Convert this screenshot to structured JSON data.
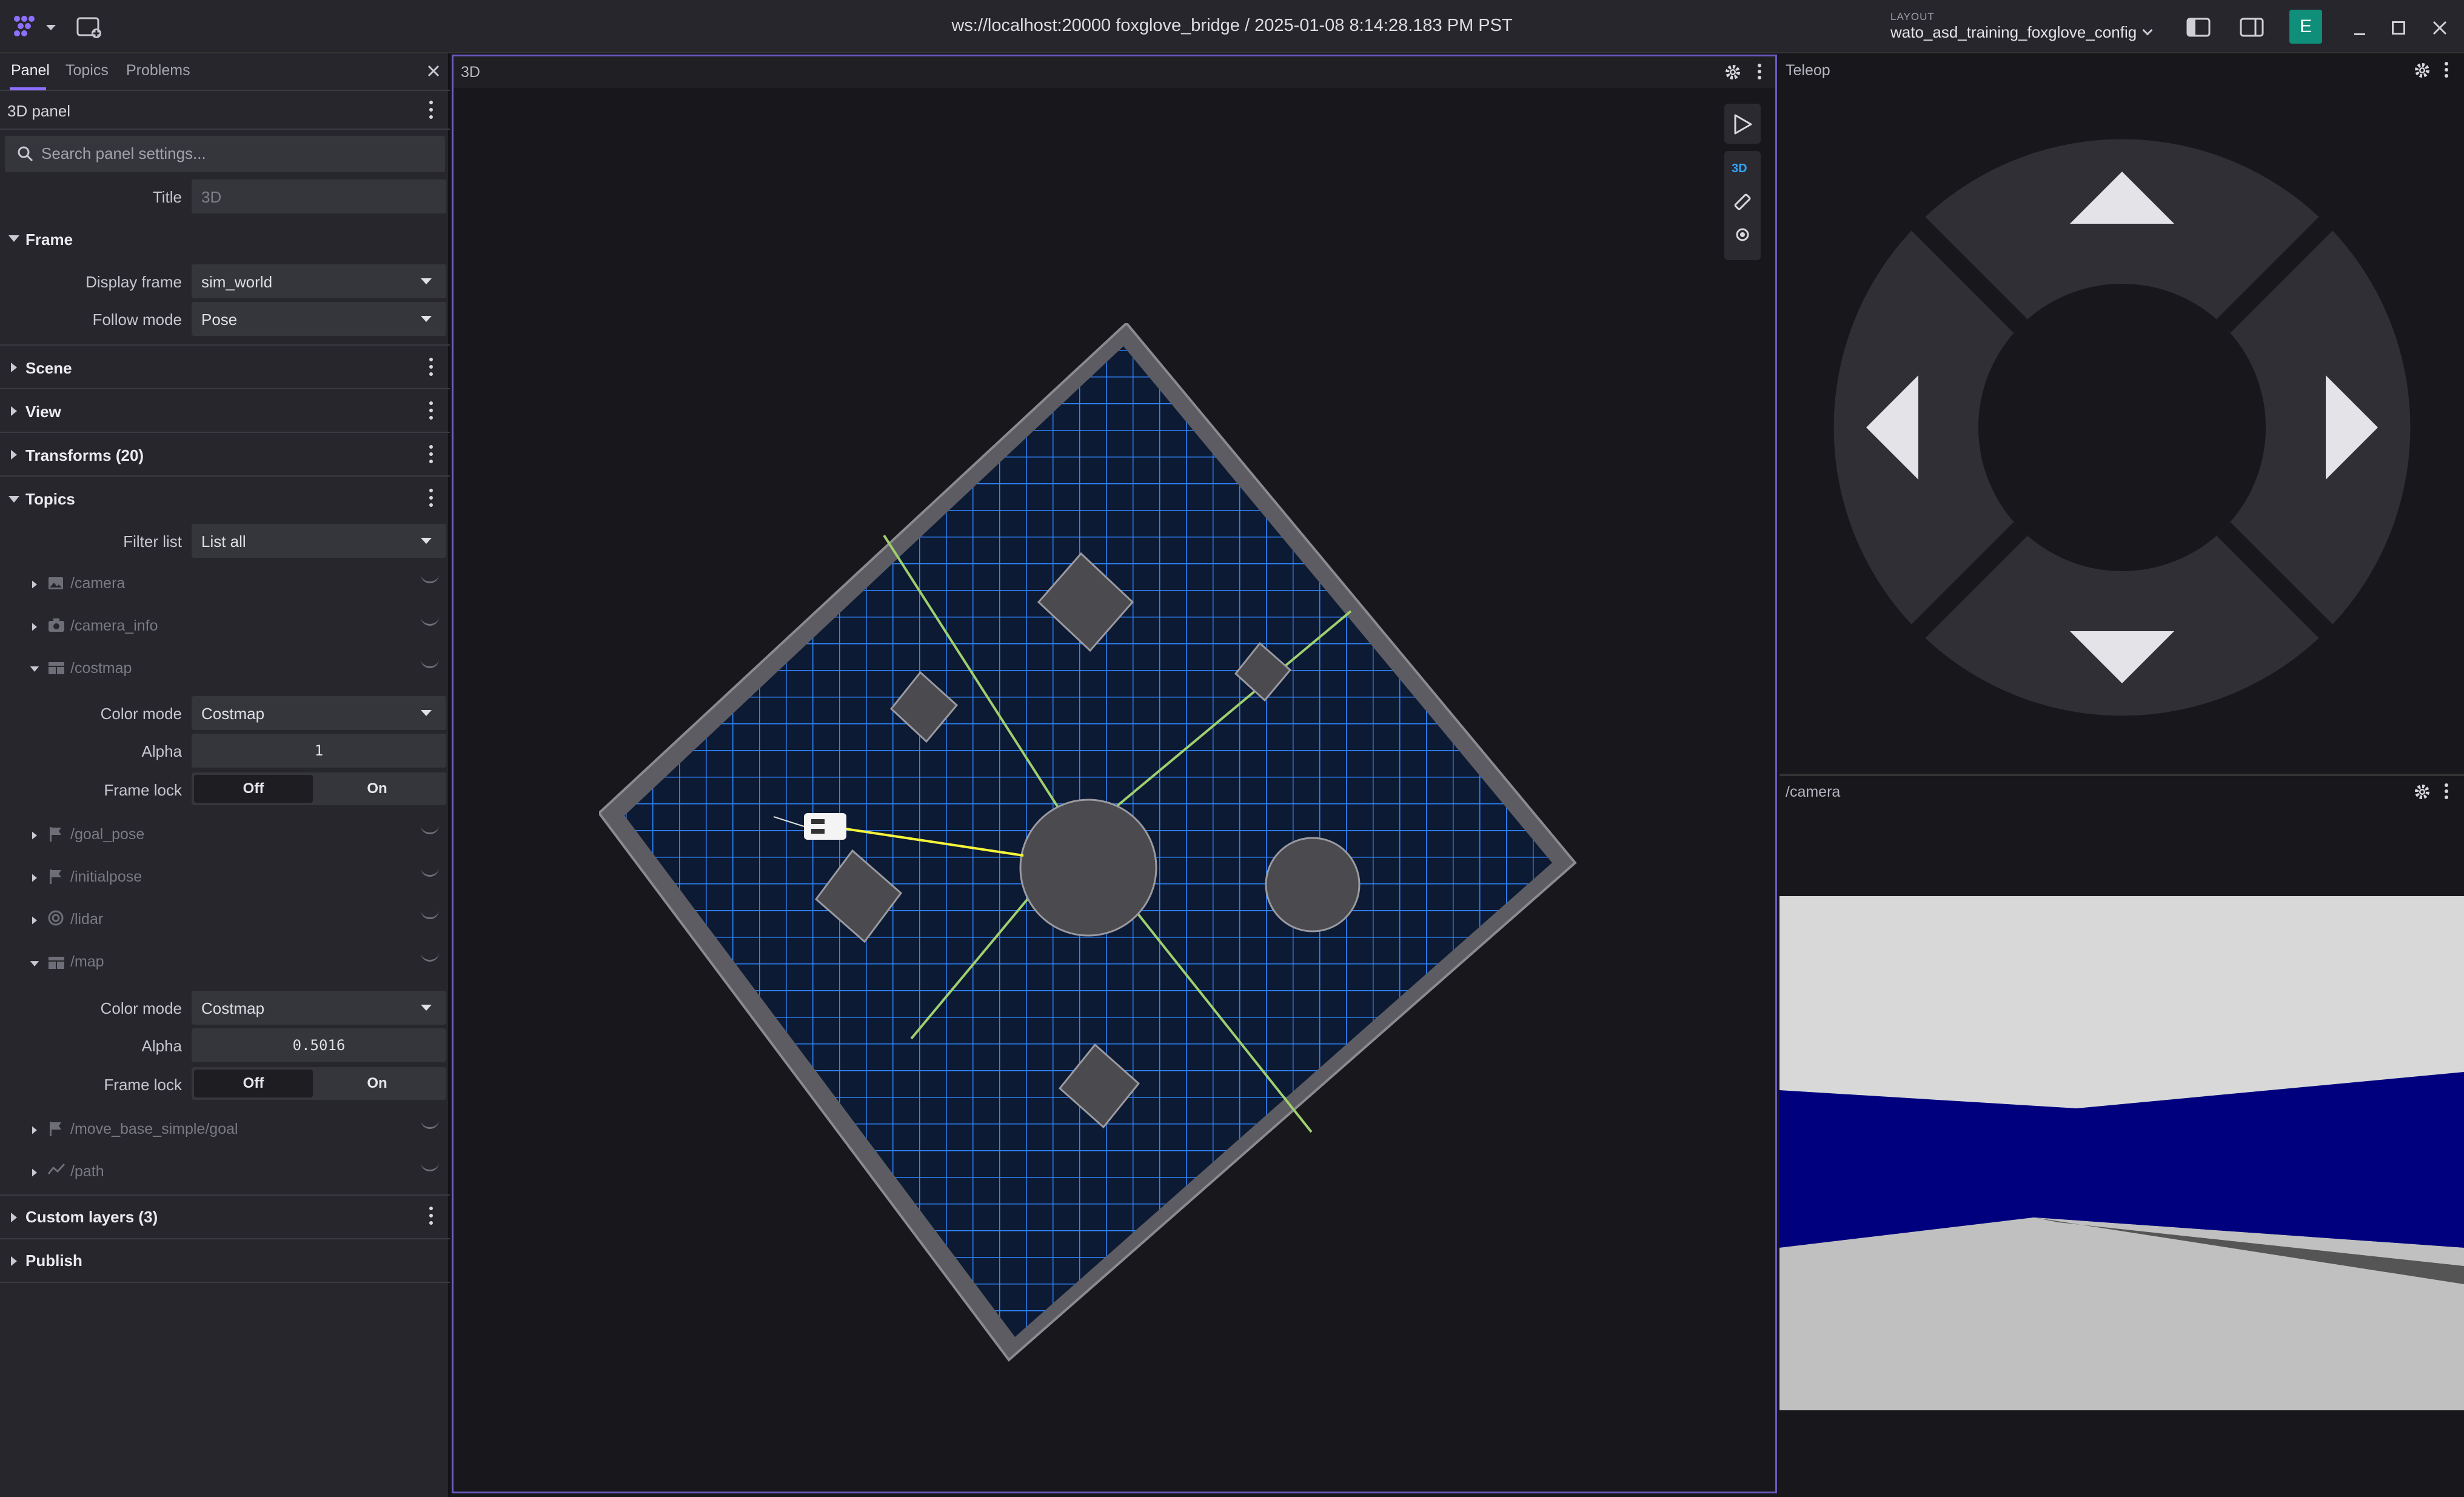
{
  "topbar": {
    "connection_title": "ws://localhost:20000 foxglove_bridge / 2025-01-08 8:14:28.183 PM PST",
    "layout_caption": "LAYOUT",
    "layout_name": "wato_asd_training_foxglove_config",
    "user_initial": "E",
    "user_color": "#0f8f7a"
  },
  "sidebar": {
    "tabs": [
      "Panel",
      "Topics",
      "Problems"
    ],
    "panel_name": "3D panel",
    "search_placeholder": "Search panel settings...",
    "title_label": "Title",
    "title_value": "3D",
    "frame": {
      "heading": "Frame",
      "display_frame_label": "Display frame",
      "display_frame_value": "sim_world",
      "follow_mode_label": "Follow mode",
      "follow_mode_value": "Pose"
    },
    "sections": [
      "Scene",
      "View",
      "Transforms (20)"
    ],
    "topics": {
      "heading": "Topics",
      "filter_label": "Filter list",
      "filter_value": "List all",
      "camera": "/camera",
      "camera_info": "/camera_info",
      "costmap": "/costmap",
      "costmap_settings": {
        "color_mode_label": "Color mode",
        "color_mode_value": "Costmap",
        "alpha_label": "Alpha",
        "alpha_value": "1",
        "frame_lock_label": "Frame lock",
        "off": "Off",
        "on": "On"
      },
      "goal_pose": "/goal_pose",
      "initialpose": "/initialpose",
      "lidar": "/lidar",
      "map": "/map",
      "map_settings": {
        "color_mode_label": "Color mode",
        "color_mode_value": "Costmap",
        "alpha_label": "Alpha",
        "alpha_value": "0.5016",
        "frame_lock_label": "Frame lock",
        "off": "Off",
        "on": "On"
      },
      "move_base": "/move_base_simple/goal",
      "path": "/path"
    },
    "custom_layers": "Custom layers (3)",
    "publish": "Publish"
  },
  "panel3d": {
    "title": "3D",
    "mode_badge": "3D"
  },
  "teleop": {
    "title": "Teleop"
  },
  "camera_panel": {
    "title": "/camera"
  },
  "colors": {
    "accent": "#8f6fff",
    "grid_blue": "#1f7bff",
    "wall_blue": "#00007f"
  }
}
